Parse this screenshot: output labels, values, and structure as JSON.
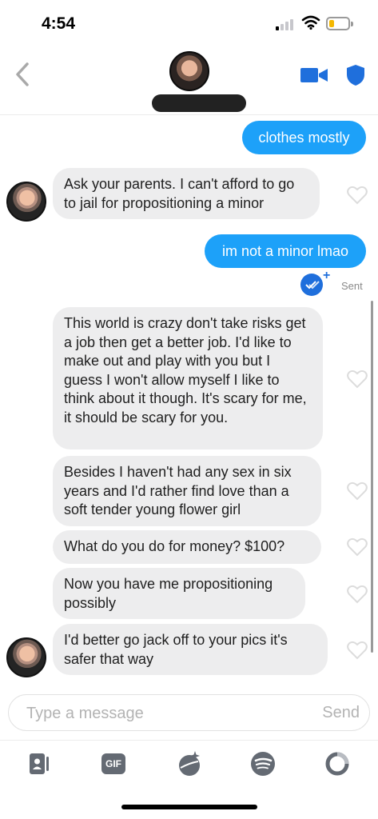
{
  "status_bar": {
    "time": "4:54"
  },
  "header": {
    "contact_name": ""
  },
  "messages": [
    {
      "side": "sent",
      "text": "clothes mostly"
    },
    {
      "side": "received",
      "text": "Ask your parents. I can't afford to go to jail for propositioning a minor"
    },
    {
      "side": "sent",
      "text": "im not a minor lmao"
    },
    {
      "side": "received",
      "text": "This world is crazy don't take risks get a job then get a better job. I'd like to make out and play with you but I guess I won't allow myself I like to think about it though. It's scary for me, it should be scary for you."
    },
    {
      "side": "received",
      "text": "Besides I haven't had any sex in six years and I'd rather find love than a soft tender young flower girl"
    },
    {
      "side": "received",
      "text": "What do you do for money?  $100?"
    },
    {
      "side": "received",
      "text": "Now you have me propositioning possibly"
    },
    {
      "side": "received",
      "text": "I'd better go jack off to your pics it's safer that way"
    }
  ],
  "delivery_status": "Sent",
  "composer": {
    "placeholder": "Type a message",
    "send_label": "Send"
  },
  "toolbar": {
    "gif_label": "GIF"
  },
  "icons": [
    "back-chevron-icon",
    "video-call-icon",
    "shield-icon",
    "heart-icon",
    "read-receipt-icon",
    "contact-card-icon",
    "gif-icon",
    "sticker-icon",
    "spotify-icon",
    "loading-ring-icon"
  ],
  "colors": {
    "accent_blue": "#1da1f9",
    "received_bubble": "#ededee",
    "icon_blue": "#1f6fdc"
  }
}
